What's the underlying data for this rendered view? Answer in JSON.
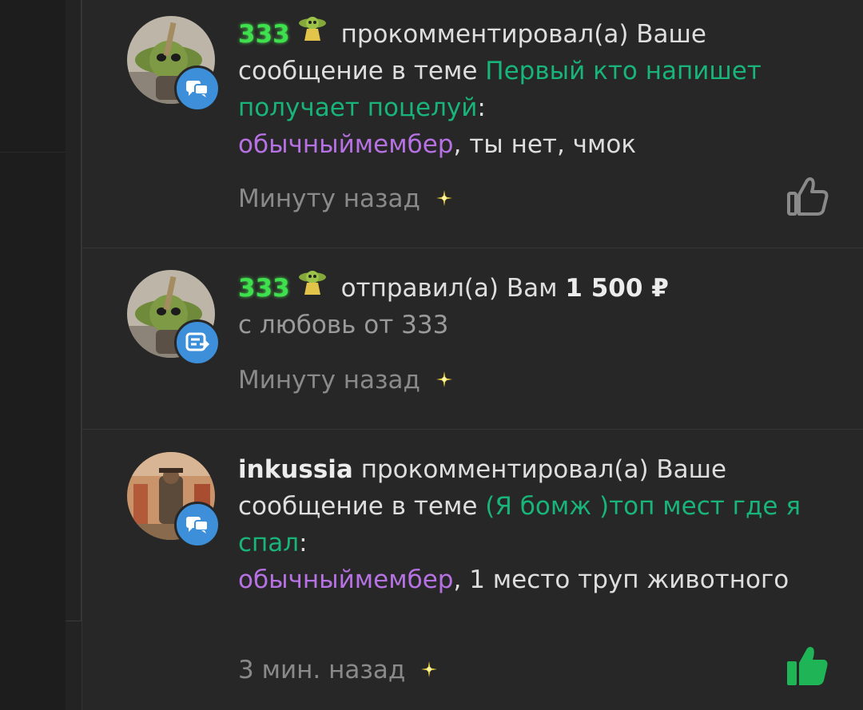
{
  "notifications": [
    {
      "username": "333",
      "action": "прокомментировал(а) Ваше сообщение в теме",
      "thread": "Первый кто напишет получает поцелуй",
      "after_thread": ":",
      "mention": "обычныймембер",
      "message": ", ты нет, чмок",
      "time": "Минуту назад",
      "badge_icon": "comment-icon",
      "liked": false
    },
    {
      "username": "333",
      "action": "отправил(а) Вам",
      "amount": "1 500 ₽",
      "note": "с любовь от 333",
      "time": "Минуту назад",
      "badge_icon": "transfer-icon"
    },
    {
      "username": "inkussia",
      "action": "прокомментировал(а) Ваше сообщение в теме",
      "thread": "(Я бомж )топ мест где я спал",
      "after_thread": ":",
      "mention": "обычныймембер",
      "message": ", 1 место труп животного",
      "time": "3 мин. назад",
      "badge_icon": "comment-icon",
      "liked": true
    }
  ],
  "colors": {
    "username_glow": "#3ee04d",
    "thread_link": "#18b47a",
    "mention": "#b671e2",
    "badge": "#3c8fd8",
    "like_active": "#1fb556",
    "like_inactive": "#8a8a8a"
  }
}
